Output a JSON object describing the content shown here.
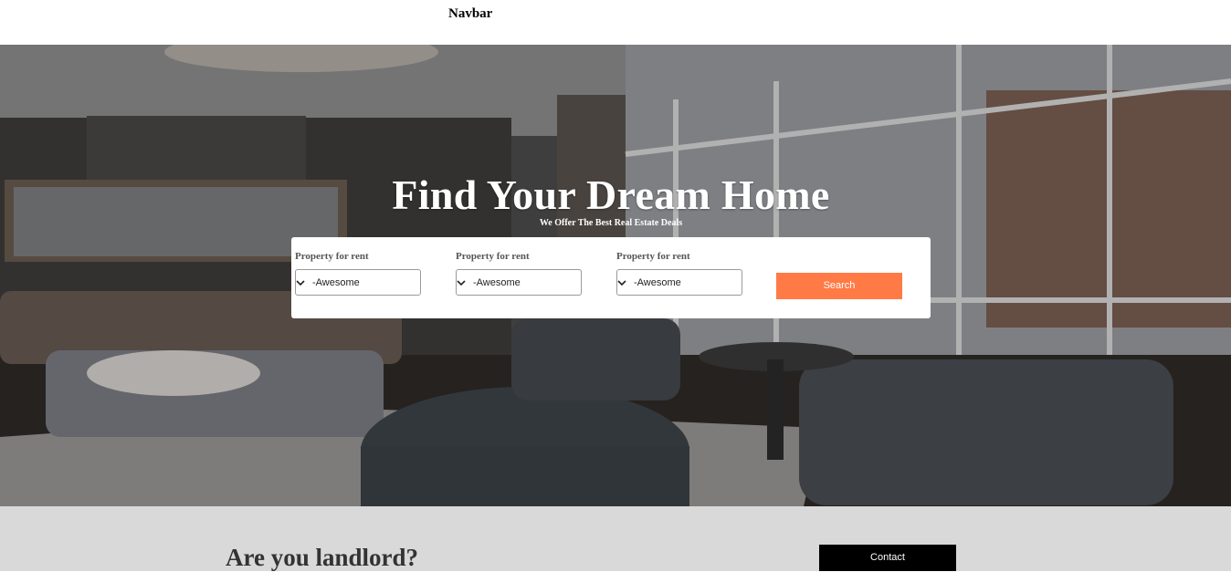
{
  "navbar": {
    "title": "Navbar"
  },
  "hero": {
    "title": "Find Your Dream Home",
    "subtitle": "We Offer The Best Real Estate Deals"
  },
  "search": {
    "fields": [
      {
        "label": "Property for rent",
        "value": "-Awesome"
      },
      {
        "label": "Property for rent",
        "value": "-Awesome"
      },
      {
        "label": "Property for rent",
        "value": "-Awesome"
      }
    ],
    "button_label": "Search"
  },
  "landlord": {
    "heading": "Are you landlord?",
    "contact_label": "Contact"
  },
  "colors": {
    "accent": "#ff7a45",
    "section_bg": "#d9d9d9",
    "contact_bg": "#000000"
  }
}
